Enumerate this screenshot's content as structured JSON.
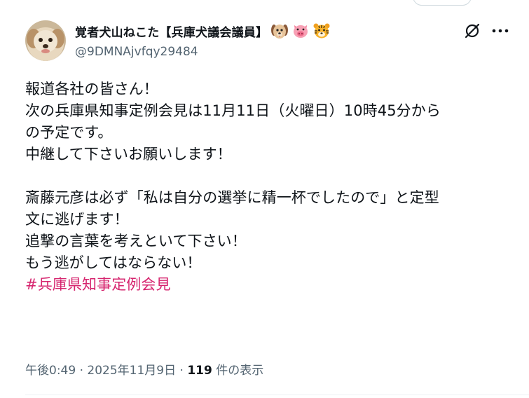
{
  "author": {
    "display_name": "覚者犬山ねこた【兵庫犬議会議員】",
    "handle": "@9DMNAjvfqy29484",
    "badges": [
      "dog-face-emoji",
      "pig-face-emoji",
      "tiger-face-emoji"
    ]
  },
  "tweet": {
    "lines": [
      "報道各社の皆さん！",
      "次の兵庫県知事定例会見は11月11日（火曜日）10時45分から",
      "の予定です。",
      "中継して下さいお願いします！",
      "",
      "斎藤元彦は必ず「私は自分の選挙に精一杯でしたので」と定型",
      "文に逃げます！",
      "追撃の言葉を考えといて下さい！",
      "もう逃がしてはならない！"
    ],
    "hashtag": "#兵庫県知事定例会見"
  },
  "meta": {
    "time": "午後0:49",
    "sep1": " · ",
    "date": "2025年11月9日",
    "sep2": " · ",
    "views_count": "119",
    "views_label": " 件の表示"
  },
  "icons": {
    "grok": "grok-icon",
    "more": "more-icon"
  },
  "colors": {
    "text": "#0f1419",
    "secondary": "#536471",
    "hashtag": "#d6246e"
  }
}
